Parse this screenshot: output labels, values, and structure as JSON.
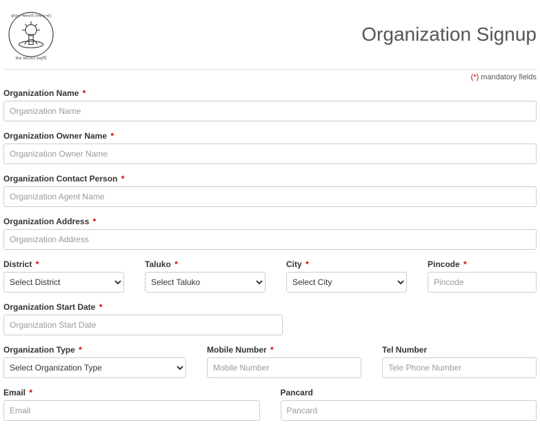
{
  "header": {
    "title": "Organization Signup",
    "mandatory_star": "(*)",
    "mandatory_text": " mandatory fields"
  },
  "fields": {
    "org_name": {
      "label": "Organization Name",
      "placeholder": "Organization Name",
      "required": "*"
    },
    "owner_name": {
      "label": "Organization Owner Name",
      "placeholder": "Organization Owner Name",
      "required": "*"
    },
    "contact_person": {
      "label": "Organization Contact Person",
      "placeholder": "Organization Agent Name",
      "required": "*"
    },
    "address": {
      "label": "Organization Address",
      "placeholder": "Organization Address",
      "required": "*"
    },
    "district": {
      "label": "District",
      "option": "Select District",
      "required": "*"
    },
    "taluko": {
      "label": "Taluko",
      "option": "Select Taluko",
      "required": "*"
    },
    "city": {
      "label": "City",
      "option": "Select City",
      "required": "*"
    },
    "pincode": {
      "label": "Pincode",
      "placeholder": "Pincode",
      "required": "*"
    },
    "start_date": {
      "label": "Organization Start Date",
      "placeholder": "Organization Start Date",
      "required": "*"
    },
    "org_type": {
      "label": "Organization Type",
      "option": "Select Organization Type",
      "required": "*"
    },
    "mobile": {
      "label": "Mobile Number",
      "placeholder": "Mobile Number",
      "required": "*"
    },
    "tel": {
      "label": "Tel Number",
      "placeholder": "Tele Phone Number"
    },
    "email": {
      "label": "Email",
      "placeholder": "Email",
      "required": "*"
    },
    "pancard": {
      "label": "Pancard",
      "placeholder": "Pancard"
    }
  }
}
